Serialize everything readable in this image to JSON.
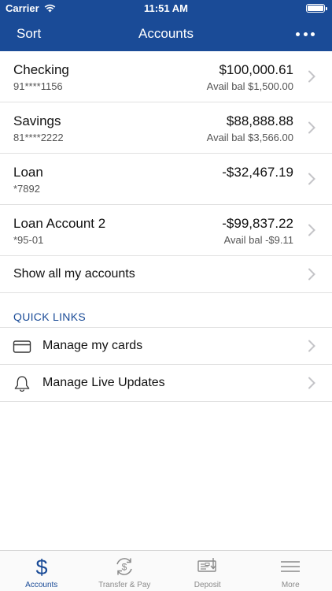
{
  "status_bar": {
    "carrier": "Carrier",
    "time": "11:51 AM",
    "battery_level": 1.0
  },
  "nav": {
    "left_button": "Sort",
    "title": "Accounts",
    "right_icon": "ellipsis-icon"
  },
  "accounts": [
    {
      "name": "Checking",
      "number": "91****1156",
      "balance": "$100,000.61",
      "available": "Avail bal $1,500.00"
    },
    {
      "name": "Savings",
      "number": "81****2222",
      "balance": "$88,888.88",
      "available": "Avail bal $3,566.00"
    },
    {
      "name": "Loan",
      "number": "*7892",
      "balance": "-$32,467.19",
      "available": ""
    },
    {
      "name": "Loan Account 2",
      "number": "*95-01",
      "balance": "-$99,837.22",
      "available": "Avail bal -$9.11"
    }
  ],
  "show_all": "Show all my accounts",
  "quick_links": {
    "header": "QUICK LINKS",
    "items": [
      {
        "label": "Manage my cards",
        "icon": "credit-card-icon"
      },
      {
        "label": "Manage Live Updates",
        "icon": "bell-icon"
      }
    ]
  },
  "tabs": [
    {
      "label": "Accounts",
      "icon": "dollar-icon",
      "active": true
    },
    {
      "label": "Transfer & Pay",
      "icon": "transfer-icon",
      "active": false
    },
    {
      "label": "Deposit",
      "icon": "check-deposit-icon",
      "active": false
    },
    {
      "label": "More",
      "icon": "menu-icon",
      "active": false
    }
  ],
  "colors": {
    "brand_blue": "#1a4b97",
    "chevron_gray": "#c4c4c8",
    "tab_inactive": "#8a8a8a"
  }
}
